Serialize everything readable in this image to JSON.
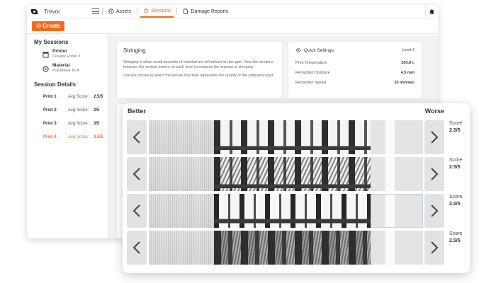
{
  "app": {
    "user_name": "Trevor",
    "nav": [
      {
        "label": "Assets",
        "icon": "compass-icon"
      },
      {
        "label": "Sessions",
        "icon": "sessions-icon",
        "active": true
      },
      {
        "label": "Damage Reports",
        "icon": "document-icon"
      }
    ],
    "create_label": "Create",
    "accent_color": "#f26a21"
  },
  "sidebar": {
    "my_sessions_heading": "My Sessions",
    "printer_label": "Printer",
    "printer_value": "Creality Ender 3",
    "material_label": "Material",
    "material_value": "PolyMaker PLA",
    "session_details_heading": "Session Details",
    "prints": [
      {
        "name": "Print 1",
        "avg_label": "Avg Score:",
        "avg": "2.5/5"
      },
      {
        "name": "Print 2",
        "avg_label": "Avg Score:",
        "avg": "2/5"
      },
      {
        "name": "Print 3",
        "avg_label": "Avg Score:",
        "avg": "3/5"
      },
      {
        "name": "Print 4",
        "avg_label": "Avg Score:",
        "avg": "3.5/5",
        "active": true
      }
    ]
  },
  "stringing": {
    "title": "Stringing",
    "description": "Stringing is when small amounts of material are left behind on the part. View the sections between the vertical towers on each level to examine the amount of stringing.",
    "instructions": "Use the arrows to select the picture that best represents the quality of the calibration part."
  },
  "quick_settings": {
    "title": "Quick Settings",
    "level": "Level 3",
    "rows": [
      {
        "label": "Print Temperature",
        "value": "203.6 c"
      },
      {
        "label": "Retraction Distance",
        "value": "4.5 mm"
      },
      {
        "label": "Retraction Speed",
        "value": "25 mm/sec"
      }
    ]
  },
  "panel": {
    "better_label": "Better",
    "worse_label": "Worse",
    "score_label": "Score",
    "rows": [
      {
        "score": "2.5/5"
      },
      {
        "score": "2.5/5"
      },
      {
        "score": "2.5/5"
      },
      {
        "score": "2.5/5"
      }
    ]
  }
}
